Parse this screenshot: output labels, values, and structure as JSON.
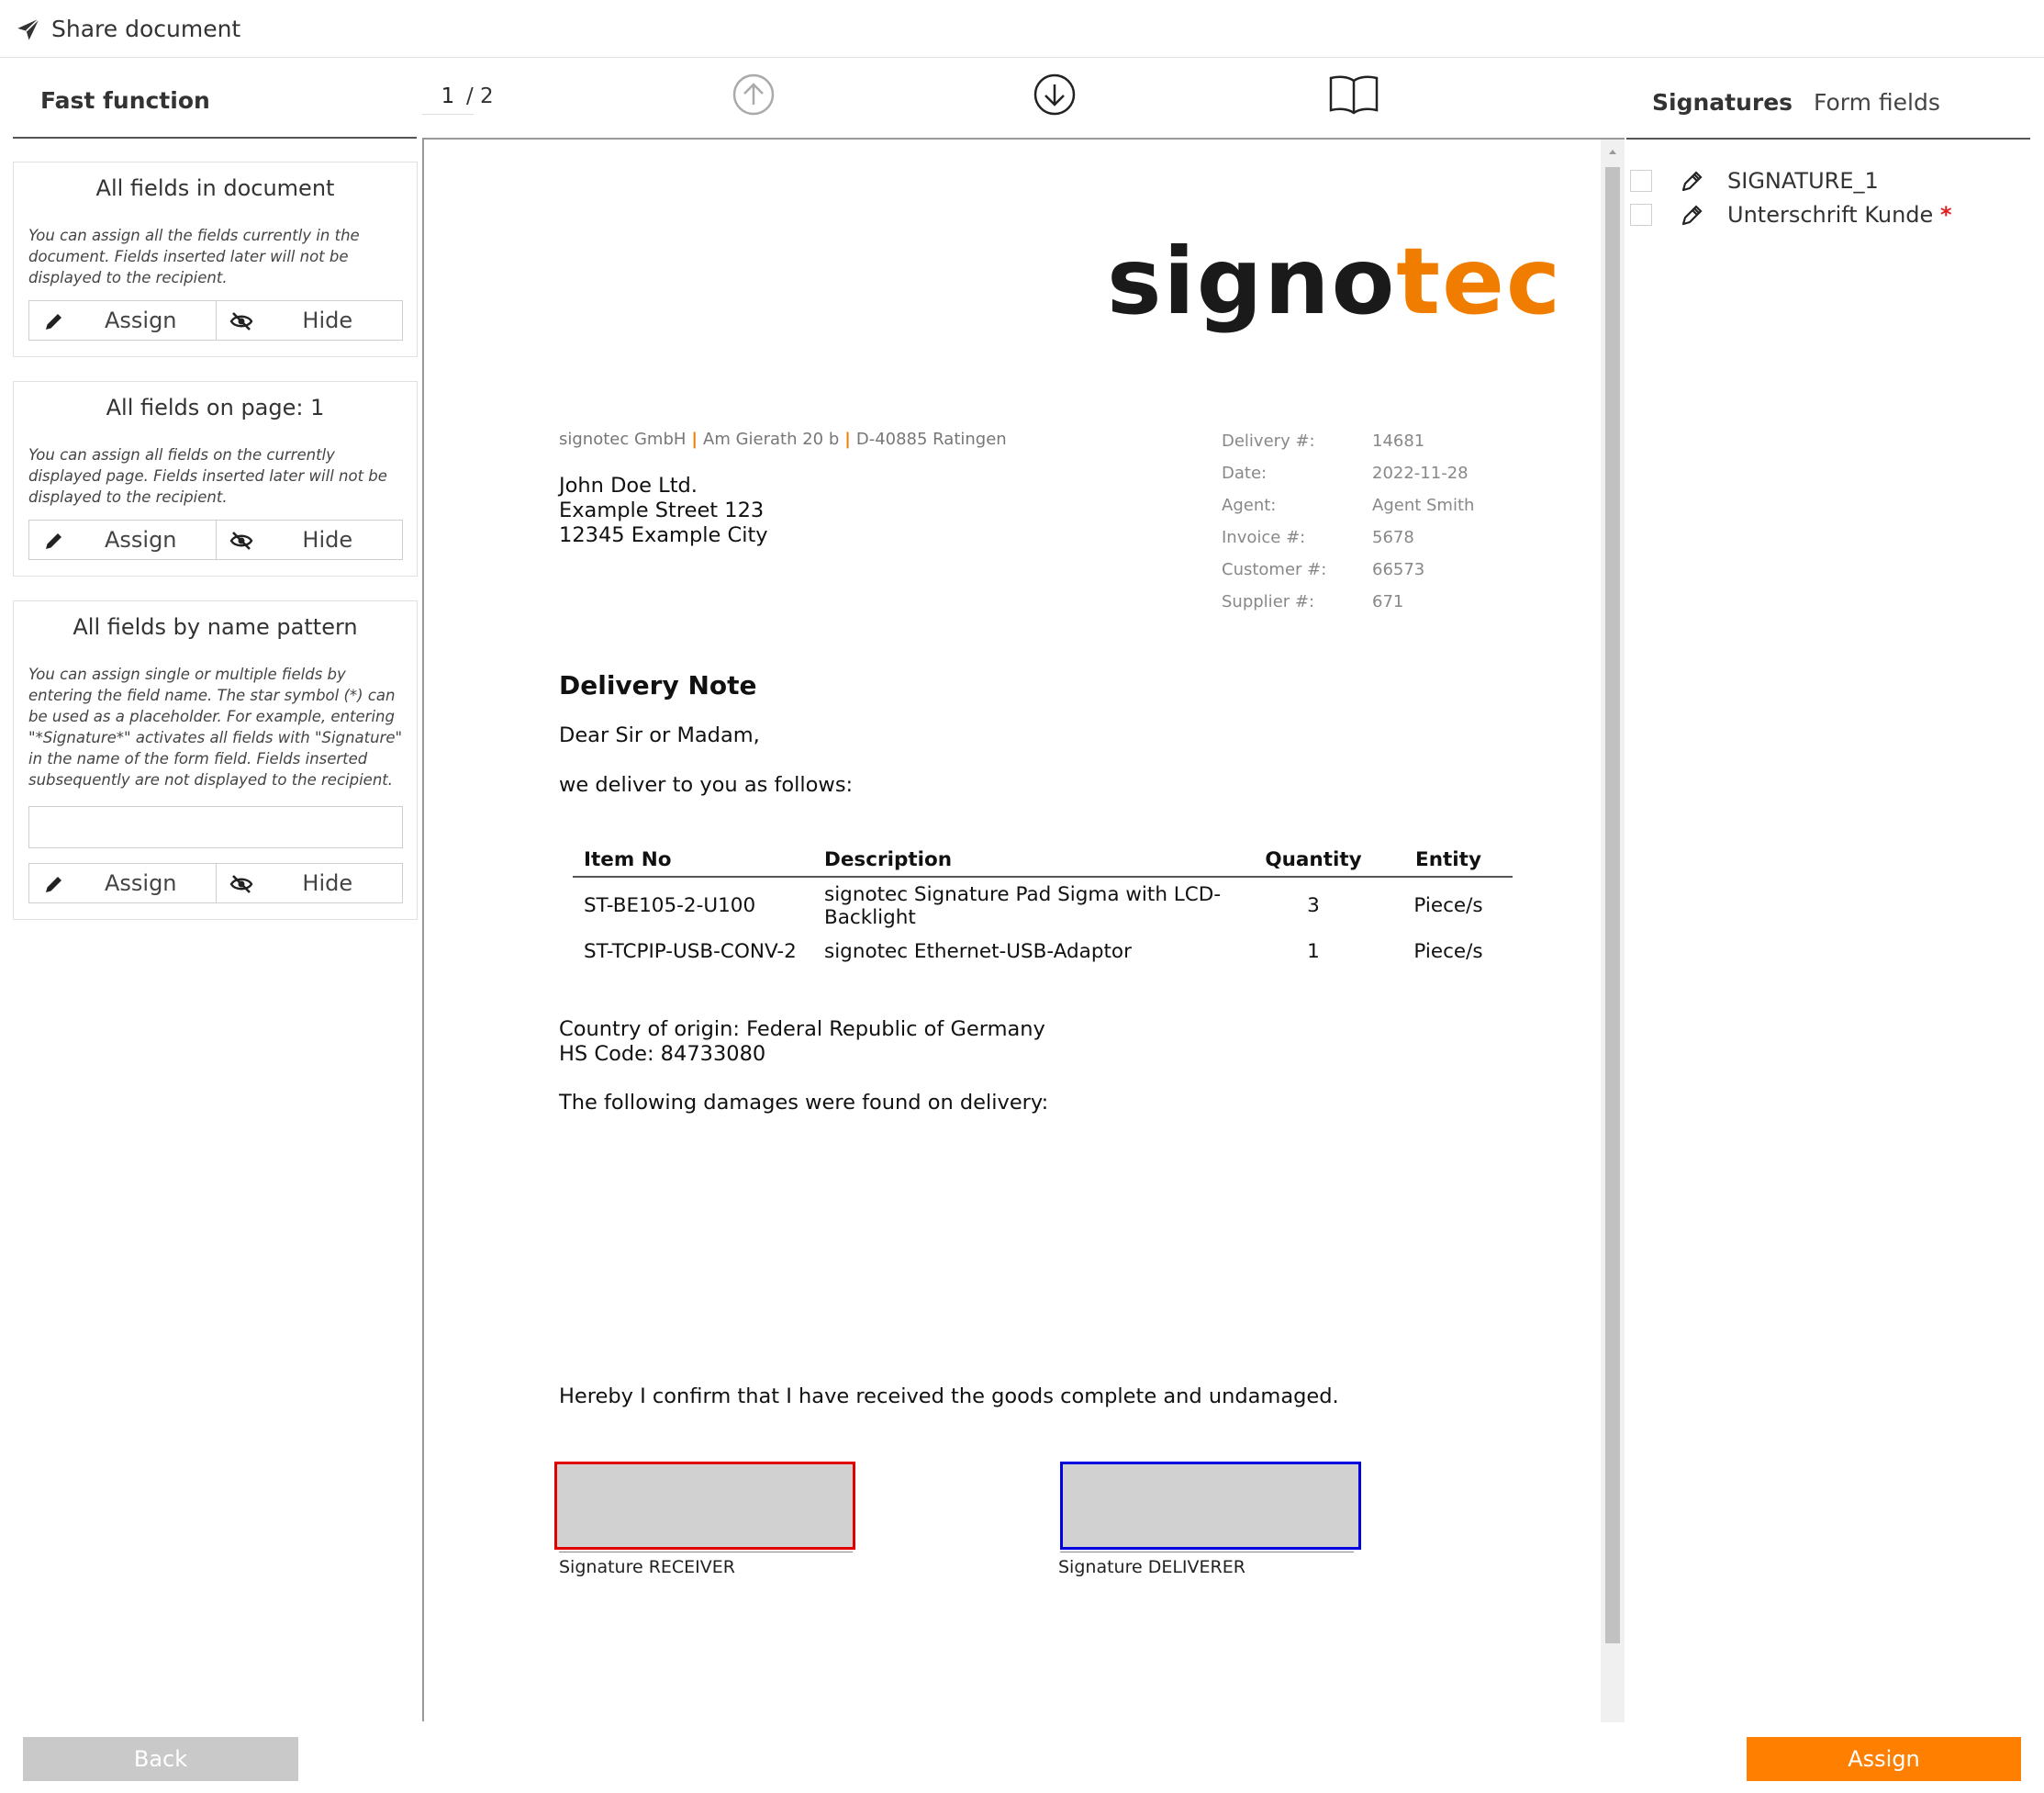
{
  "app": {
    "title": "Share document"
  },
  "sidebar": {
    "header": "Fast function",
    "cards": [
      {
        "title": "All fields in document",
        "description": "You can assign all the fields currently in the document. Fields inserted later will not be displayed to the recipient.",
        "assign_label": "Assign",
        "hide_label": "Hide"
      },
      {
        "title": "All fields on page: 1",
        "description": "You can assign all fields on the currently displayed page. Fields inserted later will not be displayed to the recipient.",
        "assign_label": "Assign",
        "hide_label": "Hide"
      },
      {
        "title": "All fields by name pattern",
        "description": "You can assign single or multiple fields by entering the field name. The star symbol (*) can be used as a placeholder. For example, entering \"*Signature*\" activates all fields with \"Signature\" in the name of the form field. Fields inserted subsequently are not displayed to the recipient.",
        "input_value": "",
        "assign_label": "Assign",
        "hide_label": "Hide"
      }
    ]
  },
  "viewer": {
    "current_page": "1",
    "total_pages": "/ 2"
  },
  "document": {
    "logo_part1": "signo",
    "logo_part2": "tec",
    "sender": [
      "signotec GmbH",
      "Am Gierath 20 b",
      "D-40885 Ratingen"
    ],
    "recipient": [
      "John Doe Ltd.",
      "Example Street 123",
      "12345 Example City"
    ],
    "meta": [
      {
        "key": "Delivery #:",
        "value": "14681"
      },
      {
        "key": "Date:",
        "value": "2022-11-28"
      },
      {
        "key": "Agent:",
        "value": "Agent Smith"
      },
      {
        "key": "Invoice #:",
        "value": "5678"
      },
      {
        "key": "Customer #:",
        "value": "66573"
      },
      {
        "key": "Supplier #:",
        "value": "671"
      }
    ],
    "title": "Delivery Note",
    "greeting": "Dear Sir or Madam,",
    "intro": "we deliver to you as follows:",
    "table": {
      "headers": [
        "Item No",
        "Description",
        "Quantity",
        "Entity"
      ],
      "rows": [
        [
          "ST-BE105-2-U100",
          "signotec Signature Pad Sigma with LCD-Backlight",
          "3",
          "Piece/s"
        ],
        [
          "ST-TCPIP-USB-CONV-2",
          "signotec Ethernet-USB-Adaptor",
          "1",
          "Piece/s"
        ]
      ]
    },
    "origin": "Country of origin: Federal Republic of Germany",
    "hs_code": "HS Code: 84733080",
    "damages": "The following damages were found on delivery:",
    "confirmation": "Hereby I confirm that I have received the goods complete and undamaged.",
    "sig_receiver_label": "Signature RECEIVER",
    "sig_deliverer_label": "Signature DELIVERER",
    "sig_receiver_color": "#e00000",
    "sig_deliverer_color": "#0000e0"
  },
  "right_panel": {
    "tabs": [
      "Signatures",
      "Form fields"
    ],
    "active_tab": "Signatures",
    "signatures": [
      {
        "name": "SIGNATURE_1",
        "required": false,
        "icon": "pen-icon"
      },
      {
        "name": "Unterschrift Kunde",
        "required": true,
        "required_mark": "*",
        "icon": "pen-icon"
      }
    ]
  },
  "footer": {
    "back_label": "Back",
    "assign_label": "Assign"
  },
  "colors": {
    "accent": "#ff7f00",
    "back_button": "#c9c9c9",
    "required": "#e02020"
  }
}
